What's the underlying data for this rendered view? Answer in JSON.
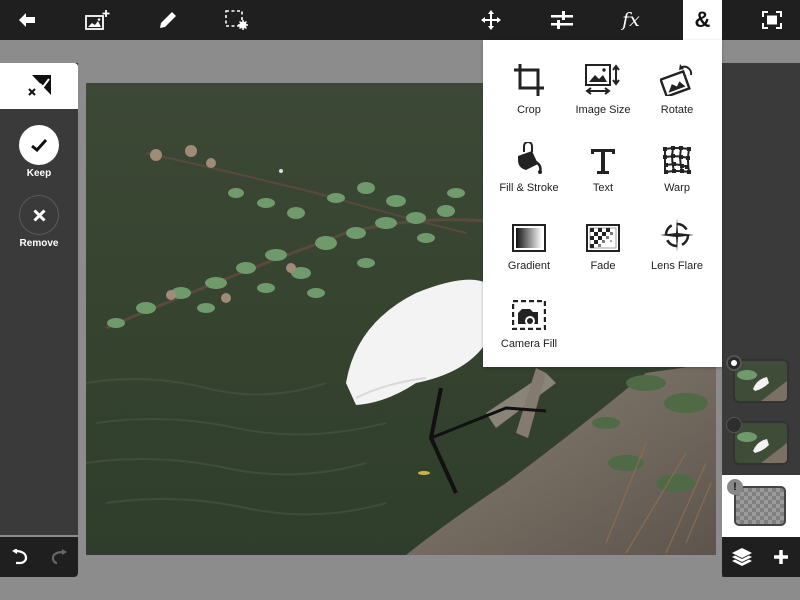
{
  "toolbar": {
    "left": [
      {
        "name": "back",
        "icon": "back-arrow-icon"
      },
      {
        "name": "add-image",
        "icon": "add-image-icon"
      },
      {
        "name": "brush",
        "icon": "pencil-icon"
      },
      {
        "name": "selection",
        "icon": "selection-settings-icon"
      }
    ],
    "right": [
      {
        "name": "move",
        "icon": "move-icon"
      },
      {
        "name": "adjustments",
        "icon": "sliders-icon"
      },
      {
        "name": "effects",
        "icon": "fx-icon",
        "label": "fx"
      },
      {
        "name": "more-tools",
        "icon": "ampersand-icon",
        "label": "&",
        "active": true
      },
      {
        "name": "fullscreen",
        "icon": "fullscreen-icon"
      }
    ]
  },
  "left_panel": {
    "mode_icon": "refine-selection-icon",
    "keep_label": "Keep",
    "remove_label": "Remove",
    "undo_icon": "undo-icon",
    "redo_icon": "redo-icon"
  },
  "tools_menu": {
    "items": [
      {
        "label": "Crop",
        "icon": "crop-icon"
      },
      {
        "label": "Image Size",
        "icon": "image-size-icon"
      },
      {
        "label": "Rotate",
        "icon": "rotate-icon"
      },
      {
        "label": "Fill & Stroke",
        "icon": "fill-bucket-icon"
      },
      {
        "label": "Text",
        "icon": "text-icon"
      },
      {
        "label": "Warp",
        "icon": "warp-icon"
      },
      {
        "label": "Gradient",
        "icon": "gradient-icon"
      },
      {
        "label": "Fade",
        "icon": "fade-icon"
      },
      {
        "label": "Lens Flare",
        "icon": "lens-flare-icon"
      },
      {
        "label": "Camera Fill",
        "icon": "camera-fill-icon"
      }
    ]
  },
  "layers": {
    "items": [
      {
        "name": "egret-layer-1",
        "visible_selected": true
      },
      {
        "name": "egret-layer-2",
        "visible_selected": false
      },
      {
        "name": "empty-layer",
        "active": true,
        "warning": "!"
      }
    ],
    "layers_icon": "layers-icon",
    "add_icon": "plus-icon"
  },
  "colors": {
    "toolbar_bg": "#1f1f1f",
    "panel_bg": "#3a3a3a",
    "workspace_bg": "#8c8c8c",
    "active_bg": "#ffffff"
  }
}
